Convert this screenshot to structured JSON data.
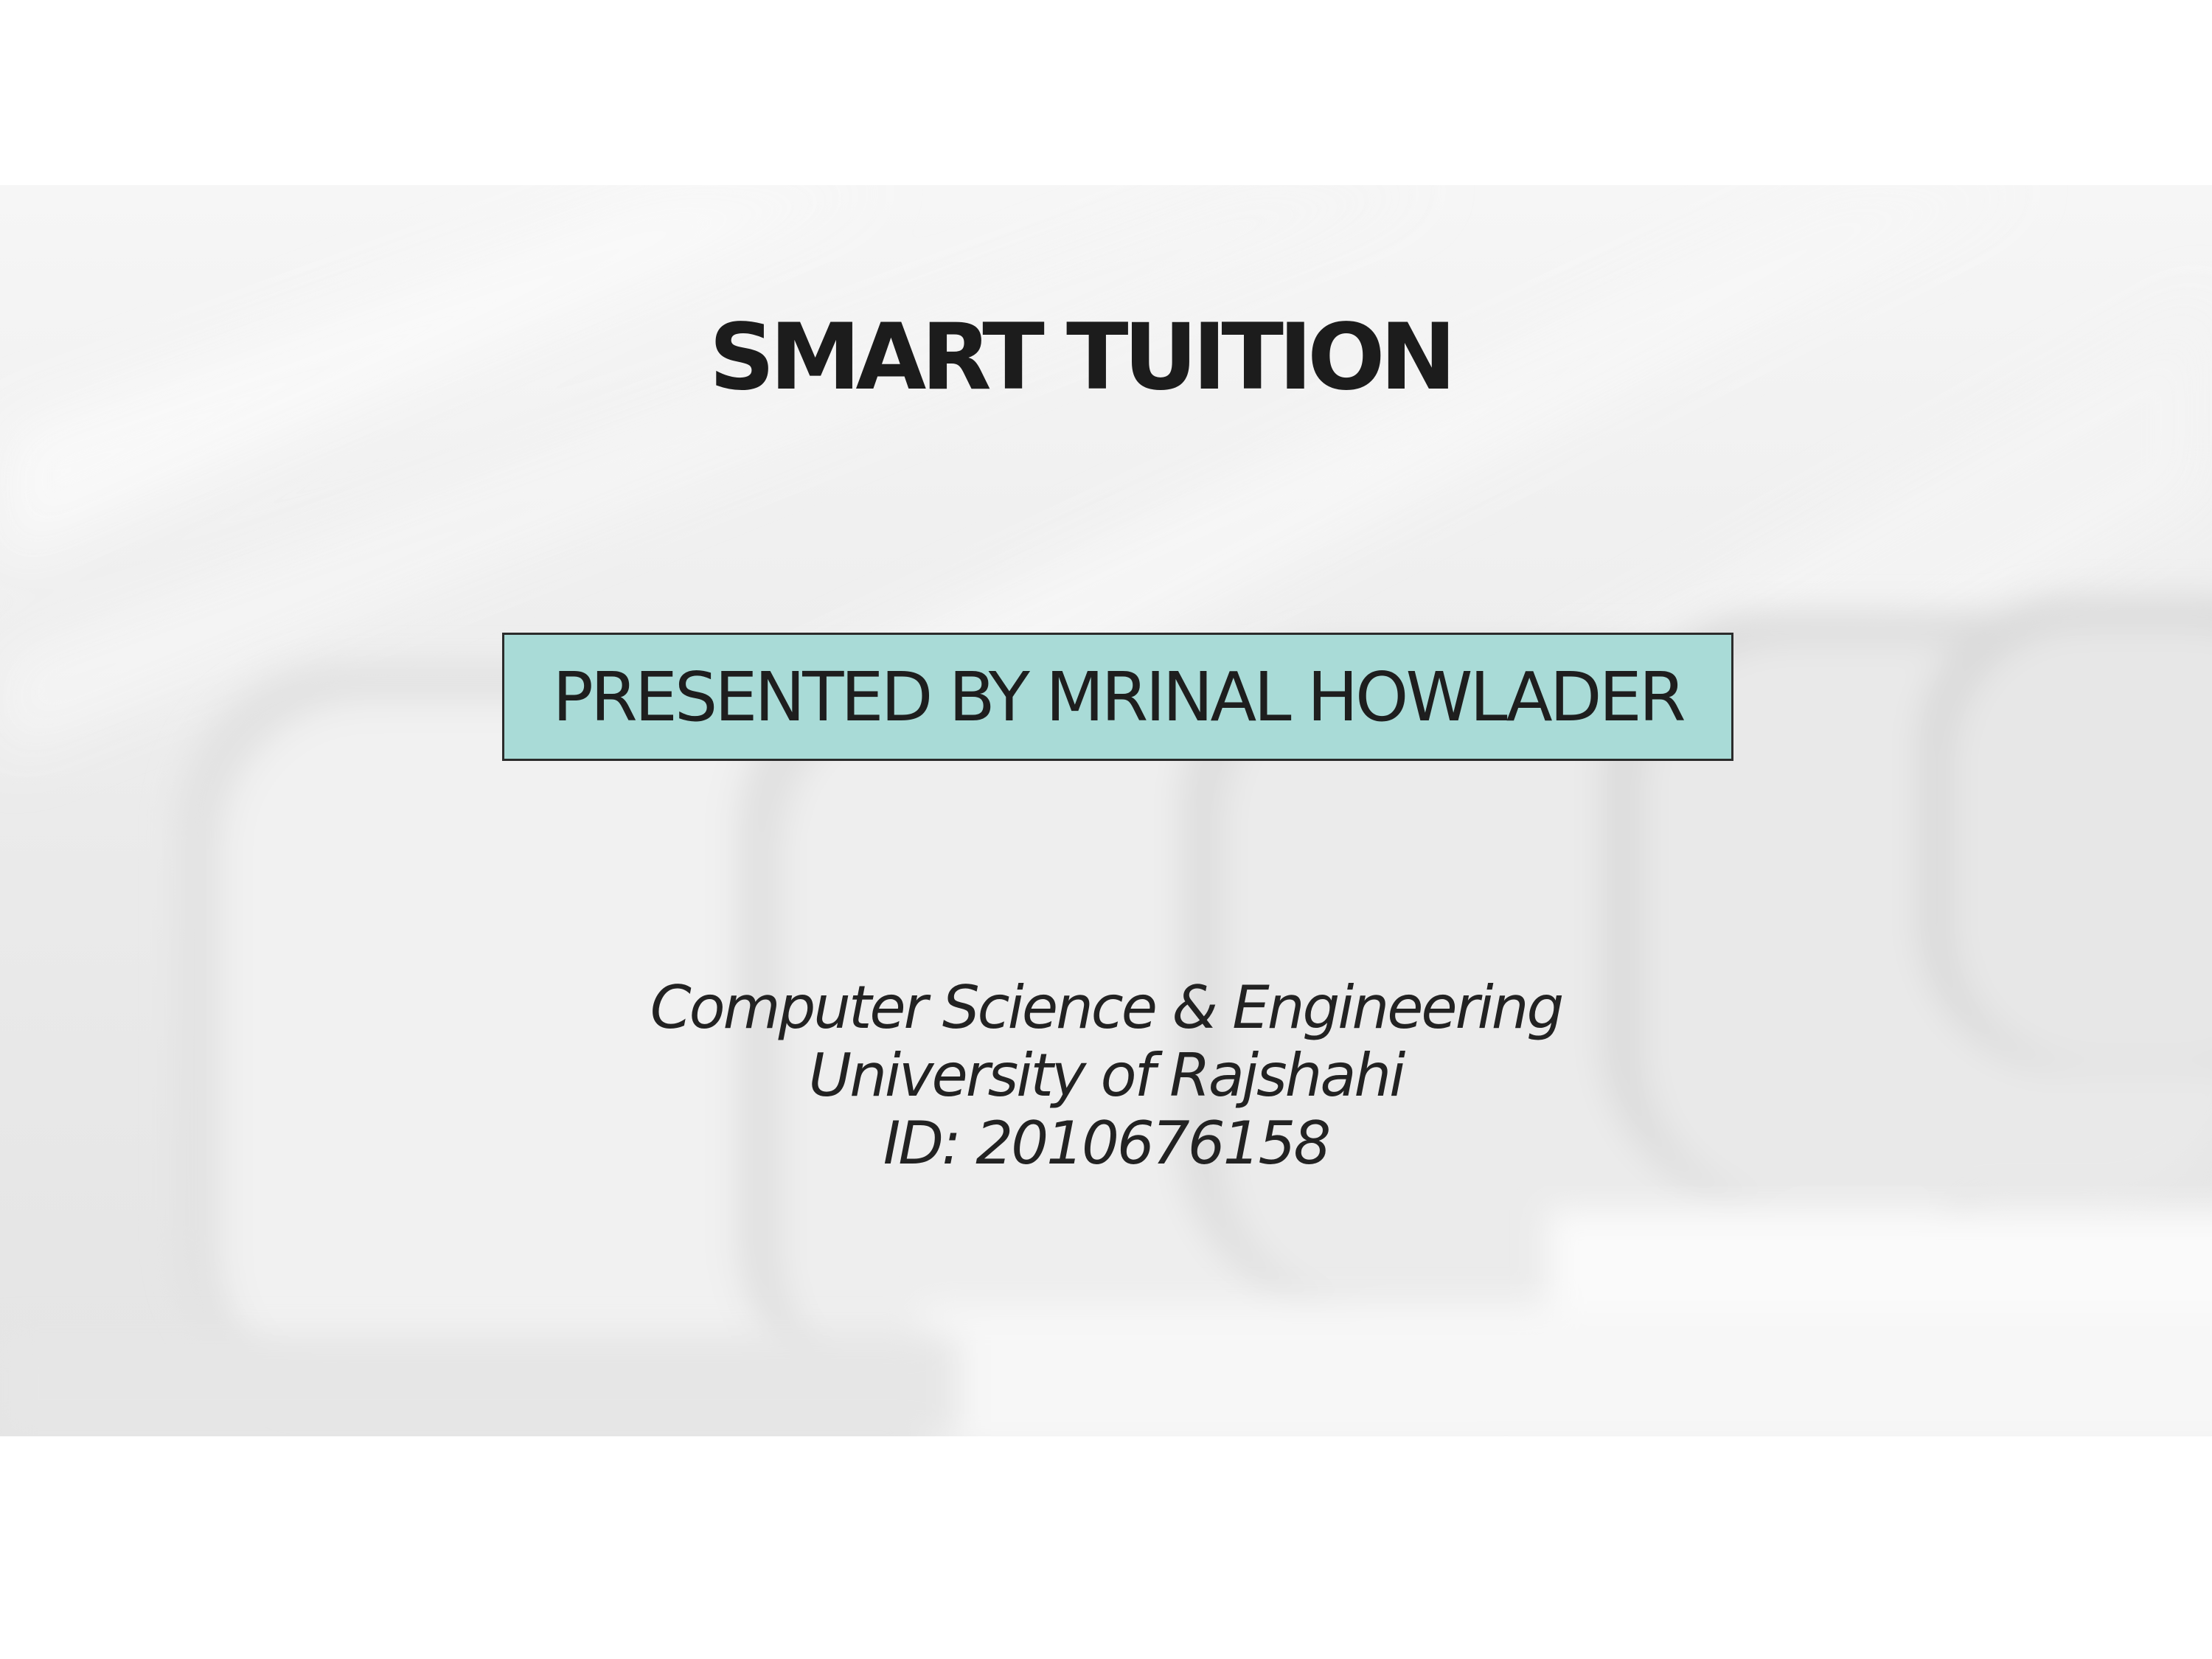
{
  "slide": {
    "title": "SMART TUITION",
    "presenter": "PRESENTED BY MRINAL HOWLADER",
    "info_lines": [
      "Computer Science & Engineering",
      "University of Rajshahi",
      "ID: 2010676158"
    ]
  },
  "colors": {
    "presenter_box_fill": "#a9dbd7",
    "text": "#1c1c1c",
    "background": "#ececec"
  }
}
